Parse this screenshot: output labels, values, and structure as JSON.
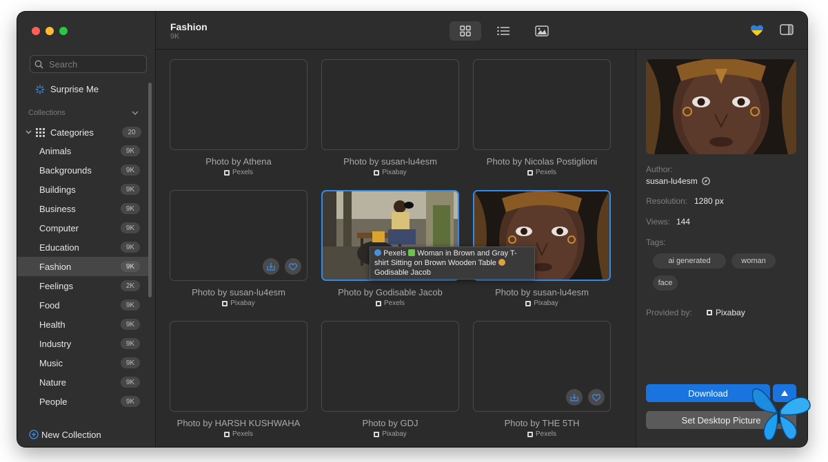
{
  "window": {
    "title": "Fashion",
    "subtitle": "9K"
  },
  "sidebar": {
    "search_placeholder": "Search",
    "surprise_label": "Surprise Me",
    "collections_label": "Collections",
    "categories": {
      "label": "Categories",
      "count": "20"
    },
    "items": [
      {
        "label": "Animals",
        "count": "9K"
      },
      {
        "label": "Backgrounds",
        "count": "9K"
      },
      {
        "label": "Buildings",
        "count": "9K"
      },
      {
        "label": "Business",
        "count": "9K"
      },
      {
        "label": "Computer",
        "count": "9K"
      },
      {
        "label": "Education",
        "count": "9K"
      },
      {
        "label": "Fashion",
        "count": "9K"
      },
      {
        "label": "Feelings",
        "count": "2K"
      },
      {
        "label": "Food",
        "count": "9K"
      },
      {
        "label": "Health",
        "count": "9K"
      },
      {
        "label": "Industry",
        "count": "9K"
      },
      {
        "label": "Music",
        "count": "9K"
      },
      {
        "label": "Nature",
        "count": "9K"
      },
      {
        "label": "People",
        "count": "9K"
      }
    ],
    "new_collection_label": "New Collection"
  },
  "toolbar": {
    "views": [
      "grid-view",
      "list-view",
      "image-view"
    ],
    "active_view": "grid-view"
  },
  "grid": {
    "cards": [
      {
        "caption": "Photo by Athena",
        "source": "Pexels"
      },
      {
        "caption": "Photo by susan-lu4esm",
        "source": "Pixabay"
      },
      {
        "caption": "Photo by Nicolas Postiglioni",
        "source": "Pexels"
      },
      {
        "caption": "Photo by susan-lu4esm",
        "source": "Pixabay"
      },
      {
        "caption": "Photo by Godisable Jacob",
        "source": "Pexels"
      },
      {
        "caption": "Photo by susan-lu4esm",
        "source": "Pixabay"
      },
      {
        "caption": "Photo by HARSH KUSHWAHA",
        "source": "Pexels"
      },
      {
        "caption": "Photo by GDJ",
        "source": "Pixabay"
      },
      {
        "caption": "Photo by THE 5TH",
        "source": "Pexels"
      }
    ],
    "tooltip": {
      "source": "Pexels",
      "text": "Woman in Brown and Gray T-shirt Sitting on Brown Wooden Table",
      "author": "Godisable Jacob"
    }
  },
  "detail": {
    "author_label": "Author:",
    "author": "susan-lu4esm",
    "resolution_label": "Resolution:",
    "resolution": "1280 px",
    "views_label": "Views:",
    "views": "144",
    "tags_label": "Tags:",
    "tags": [
      "ai generated",
      "woman",
      "face"
    ],
    "provided_label": "Provided by:",
    "provider": "Pixabay",
    "download_label": "Download",
    "set_desktop_label": "Set Desktop Picture"
  },
  "colors": {
    "accent": "#1a74e0",
    "selection_border": "#2e8cf0",
    "window_bg": "#2b2b2b"
  }
}
